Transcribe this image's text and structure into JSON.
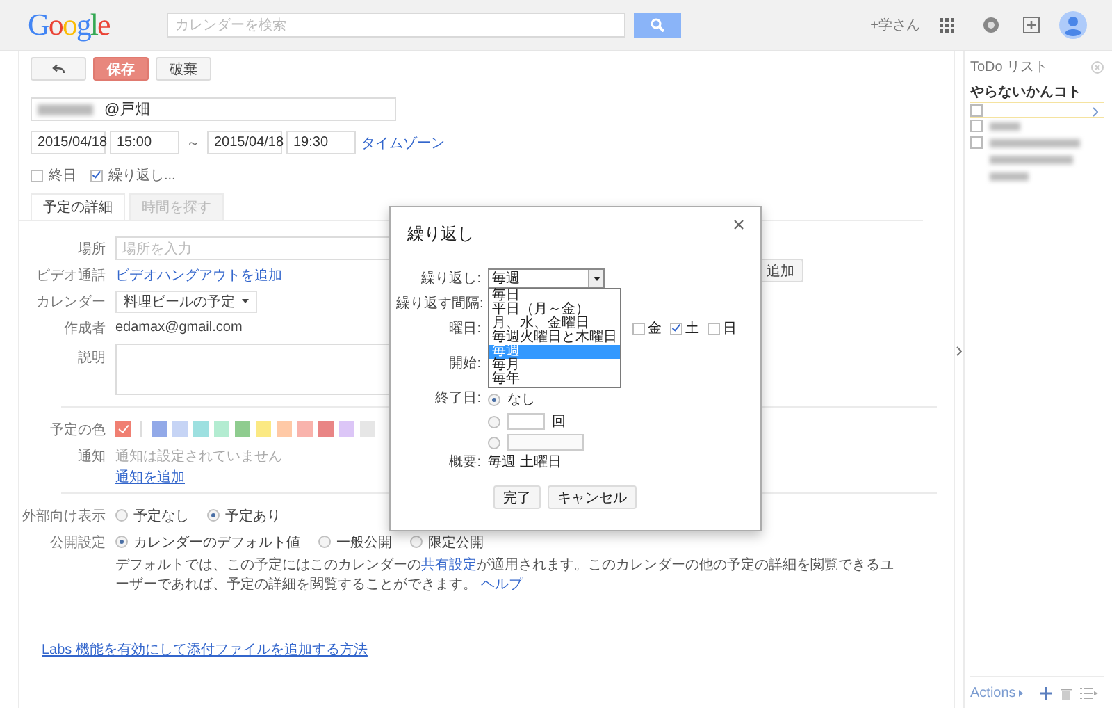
{
  "header": {
    "logo": "Google",
    "search_placeholder": "カレンダーを検索",
    "user": "+学さん"
  },
  "toolbar": {
    "buttons": [
      {
        "kind": "back"
      },
      {
        "kind": "primary",
        "label": "保存"
      },
      {
        "kind": "default",
        "label": "破棄"
      }
    ]
  },
  "event": {
    "title": "@戸畑",
    "start_date": "2015/04/18",
    "start_time": "15:00",
    "separator": "～",
    "end_date": "2015/04/18",
    "end_time": "19:30",
    "timezone_link": "タイムゾーン"
  },
  "options": [
    {
      "label": "終日",
      "checked": false
    },
    {
      "label": "繰り返し...",
      "checked": true
    }
  ],
  "tabs": [
    {
      "label": "予定の詳細",
      "selected": true
    },
    {
      "label": "時間を探す",
      "selected": false
    }
  ],
  "details": [
    {
      "kind": "input",
      "label": "場所",
      "placeholder": "場所を入力"
    },
    {
      "kind": "link",
      "label": "ビデオ通話",
      "value": "ビデオハングアウトを追加"
    },
    {
      "kind": "select",
      "label": "カレンダー",
      "value": "料理ビールの予定"
    },
    {
      "kind": "text",
      "label": "作成者",
      "value": "edamax@gmail.com"
    },
    {
      "kind": "textarea",
      "label": "説明"
    }
  ],
  "guests": {
    "add_button": "追加"
  },
  "color_row": {
    "label": "予定の色",
    "colors": [
      {
        "color": "#f07f72",
        "selected": true
      },
      {
        "color": "#92a9e8",
        "selected": false
      },
      {
        "color": "#c6d4f5",
        "selected": false
      },
      {
        "color": "#9de0e0",
        "selected": false
      },
      {
        "color": "#b3ecd1",
        "selected": false
      },
      {
        "color": "#8fcc8f",
        "selected": false
      },
      {
        "color": "#fbe983",
        "selected": false
      },
      {
        "color": "#ffc9a6",
        "selected": false
      },
      {
        "color": "#f9b3ac",
        "selected": false
      },
      {
        "color": "#e98585",
        "selected": false
      },
      {
        "color": "#dcc6f7",
        "selected": false
      },
      {
        "color": "#e6e6e6",
        "selected": false
      }
    ]
  },
  "notification": {
    "label": "通知",
    "text": "通知は設定されていません",
    "link": "通知を追加"
  },
  "visibility": {
    "label": "外部向け表示",
    "options": [
      {
        "label": "予定なし",
        "selected": false
      },
      {
        "label": "予定あり",
        "selected": true
      }
    ]
  },
  "privacy": {
    "label": "公開設定",
    "options": [
      {
        "label": "カレンダーのデフォルト値",
        "selected": true
      },
      {
        "label": "一般公開",
        "selected": false
      },
      {
        "label": "限定公開",
        "selected": false
      }
    ],
    "note_before": "デフォルトでは、この予定にはこのカレンダーの",
    "note_link": "共有設定",
    "note_after": "が適用されます。このカレンダーの他の予定の詳細を閲覧できるユーザーであれば、予定の詳細を閲覧することができます。",
    "help_link": "ヘルプ"
  },
  "labs_link": "Labs 機能を有効にして添付ファイルを追加する方法",
  "todo": {
    "title": "ToDo リスト",
    "list_name": "やらないかんコト",
    "items": [
      {
        "kind": "blank",
        "checked": false,
        "selected": true
      },
      {
        "kind": "blurred",
        "checked": false,
        "selected": false
      },
      {
        "kind": "blurred_long",
        "checked": false,
        "selected": false
      }
    ],
    "actions": "Actions"
  },
  "dialog": {
    "title": "繰り返し",
    "repeat_label": "繰り返し:",
    "repeat_value": "毎週",
    "repeat_options": [
      {
        "label": "毎日",
        "selected": false
      },
      {
        "label": "平日（月～金）",
        "selected": false
      },
      {
        "label": "月、水、金曜日",
        "selected": false
      },
      {
        "label": "毎週火曜日と木曜日",
        "selected": false
      },
      {
        "label": "毎週",
        "selected": true
      },
      {
        "label": "毎月",
        "selected": false
      },
      {
        "label": "毎年",
        "selected": false
      }
    ],
    "interval_label": "繰り返す間隔:",
    "weekday_label": "曜日:",
    "weekdays": [
      {
        "label": "金",
        "checked": false
      },
      {
        "label": "土",
        "checked": true
      },
      {
        "label": "日",
        "checked": false
      }
    ],
    "start_label": "開始:",
    "end_label": "終了日:",
    "end_options": [
      {
        "kind": "none",
        "label": "なし",
        "selected": true
      },
      {
        "kind": "count",
        "unit": "回",
        "selected": false
      },
      {
        "kind": "date",
        "selected": false
      }
    ],
    "summary_label": "概要:",
    "summary": "毎週 土曜日",
    "buttons": [
      {
        "label": "完了"
      },
      {
        "label": "キャンセル"
      }
    ]
  }
}
